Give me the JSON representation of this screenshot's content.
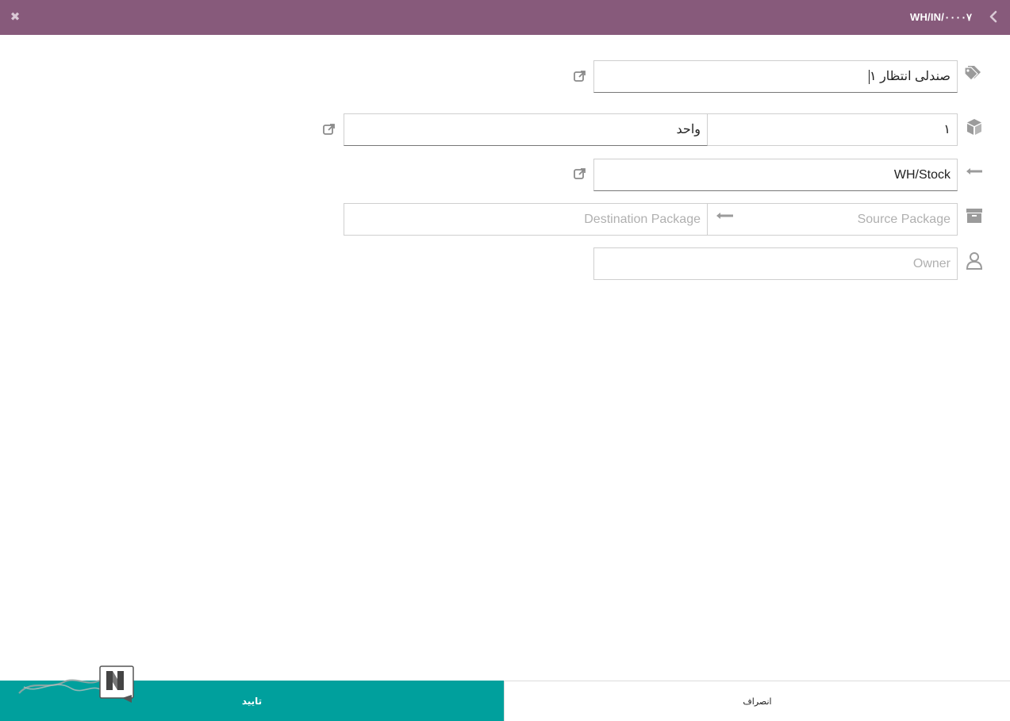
{
  "header": {
    "title": "WH/IN/۰۰۰۰۷",
    "close_icon": "close-icon",
    "back_icon": "chevron-left-icon",
    "background": "#875a7b"
  },
  "form": {
    "product": {
      "value": "صندلی انتظار ۱",
      "icon": "tags-icon"
    },
    "quantity": {
      "value": "۱",
      "icon": "cube-icon"
    },
    "uom": {
      "value": "واحد"
    },
    "location": {
      "value": "WH/Stock",
      "icon": "arrow-left-icon"
    },
    "source_package": {
      "placeholder": "Source Package",
      "icon": "archive-icon"
    },
    "destination_package": {
      "placeholder": "Destination Package"
    },
    "owner": {
      "placeholder": "Owner",
      "icon": "user-icon"
    }
  },
  "footer": {
    "confirm_label": "تایید",
    "cancel_label": "انصراف",
    "confirm_color": "#00a09d"
  }
}
